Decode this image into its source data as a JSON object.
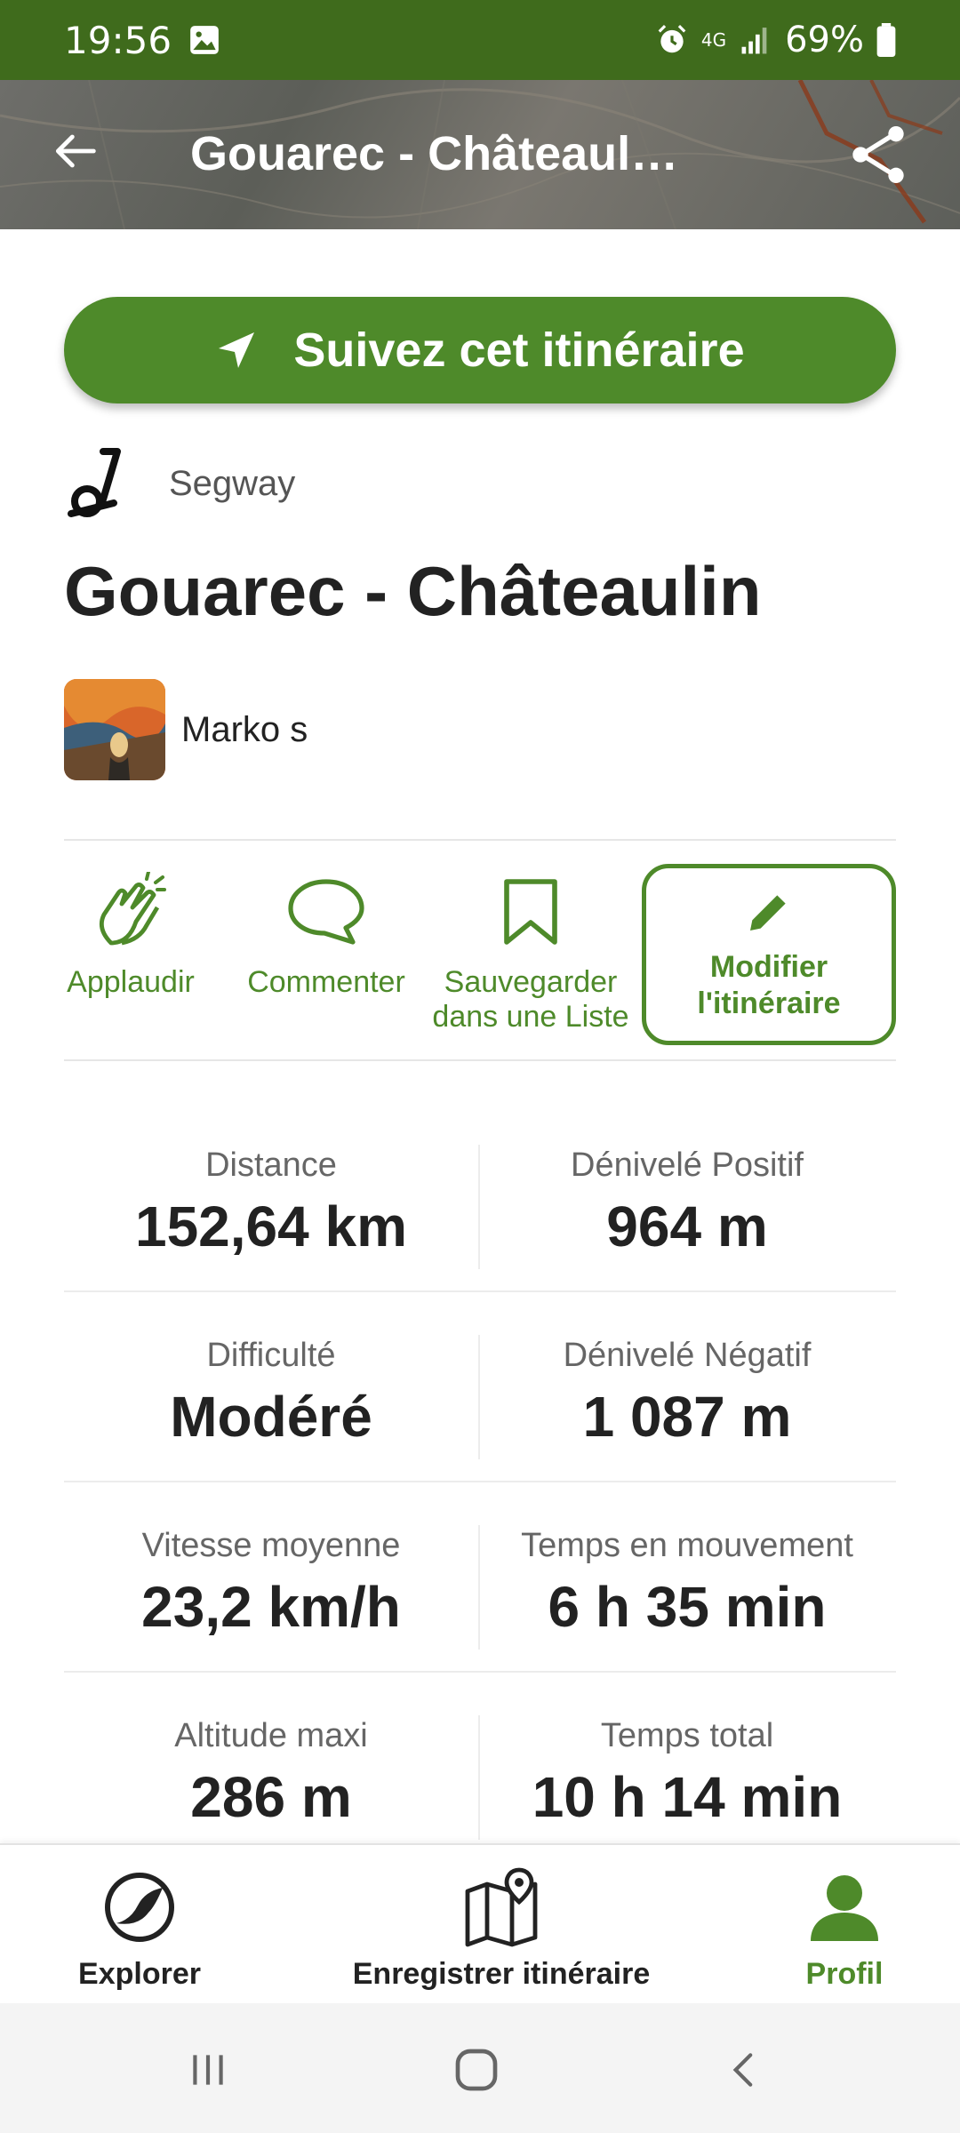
{
  "status_bar": {
    "time": "19:56",
    "network": "4G",
    "battery": "69%"
  },
  "app_bar": {
    "title": "Gouarec - Châteaul…"
  },
  "follow_button": {
    "label": "Suivez cet itinéraire"
  },
  "activity": {
    "type": "Segway"
  },
  "route": {
    "title": "Gouarec - Châteaulin"
  },
  "author": {
    "name": "Marko s"
  },
  "actions": {
    "applaud": "Applaudir",
    "comment": "Commenter",
    "save_line1": "Sauvegarder",
    "save_line2": "dans une Liste",
    "edit_line1": "Modifier",
    "edit_line2": "l'itinéraire"
  },
  "stats": [
    {
      "left_label": "Distance",
      "left_value": "152,64 km",
      "right_label": "Dénivelé Positif",
      "right_value": "964 m"
    },
    {
      "left_label": "Difficulté",
      "left_value": "Modéré",
      "right_label": "Dénivelé Négatif",
      "right_value": "1 087 m"
    },
    {
      "left_label": "Vitesse moyenne",
      "left_value": "23,2 km/h",
      "right_label": "Temps en mouvement",
      "right_value": "6 h 35 min"
    },
    {
      "left_label": "Altitude maxi",
      "left_value": "286 m",
      "right_label": "Temps total",
      "right_value": "10 h 14 min"
    }
  ],
  "bottom_nav": {
    "explore": "Explorer",
    "record": "Enregistrer itinéraire",
    "profile": "Profil",
    "active": "profile"
  },
  "colors": {
    "brand_green": "#4e8a2a",
    "status_bar": "#3f6b1c"
  }
}
